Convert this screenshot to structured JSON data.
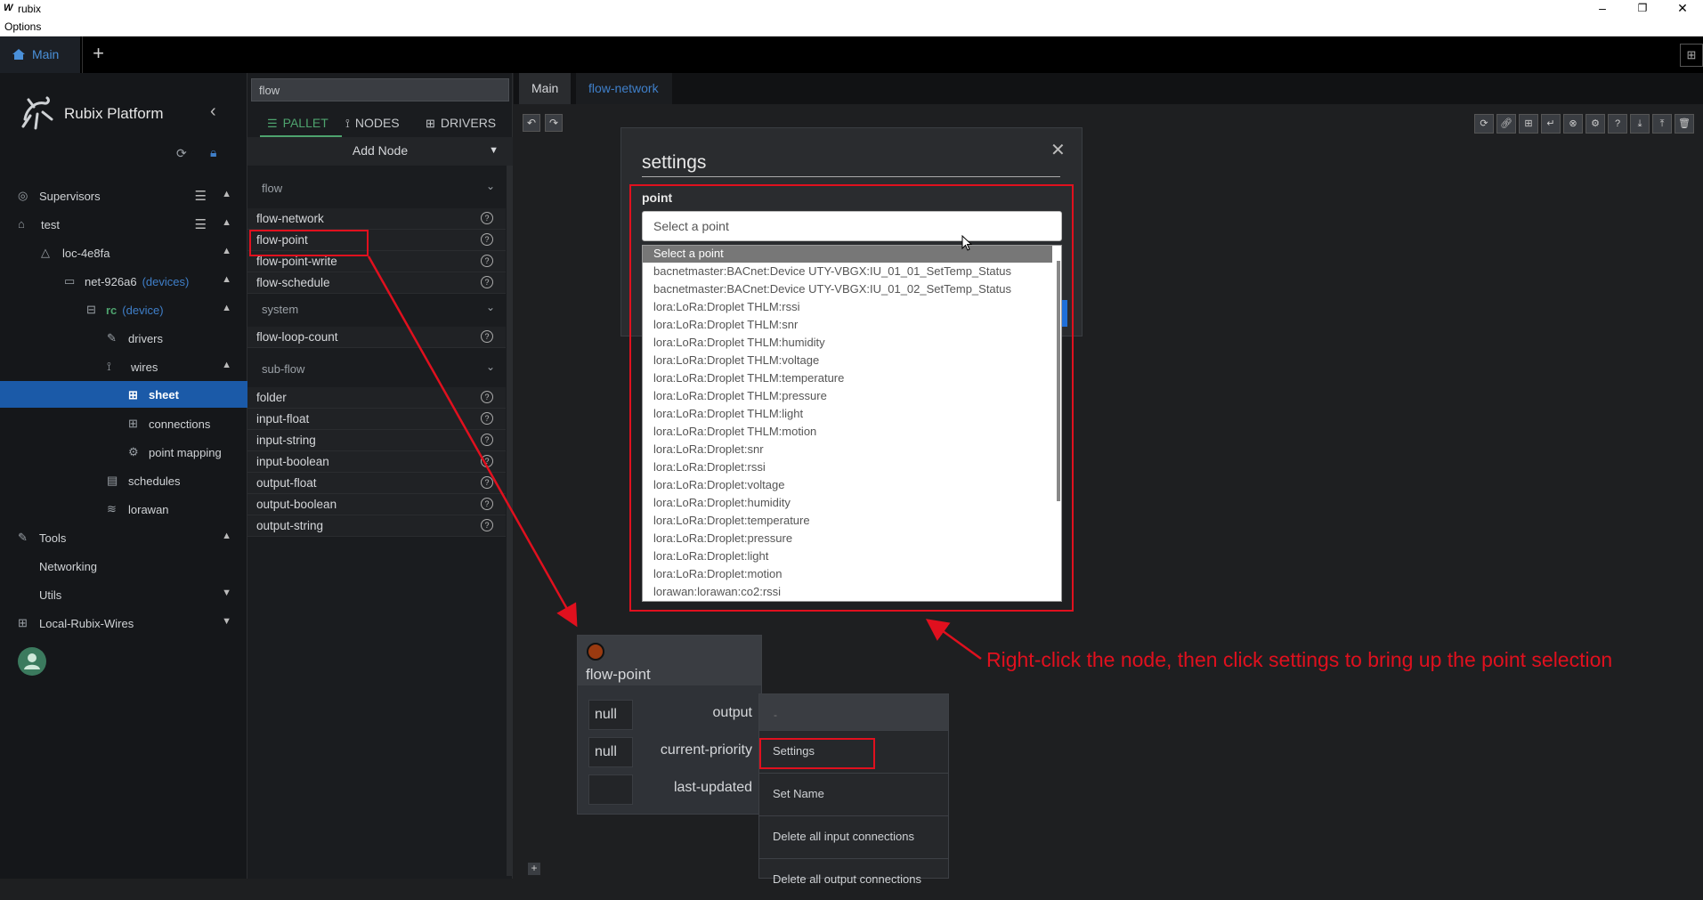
{
  "window": {
    "title": "rubix",
    "menu_options": "Options",
    "minimize": "–",
    "restore": "❐",
    "close": "✕"
  },
  "top_tabs": {
    "main": "Main",
    "add": "+"
  },
  "sidebar": {
    "brand": "Rubix Platform",
    "tree": [
      {
        "label": "Supervisors",
        "icon": "supervisors-icon"
      },
      {
        "label": "test",
        "icon": "home-icon"
      },
      {
        "label": "loc-4e8fa",
        "icon": "location-icon"
      },
      {
        "label": "net-926a6",
        "tag": "(devices)",
        "icon": "network-icon"
      },
      {
        "label": "rc",
        "tag": "(device)",
        "icon": "device-icon"
      },
      {
        "label": "drivers",
        "icon": "drivers-icon"
      },
      {
        "label": "wires",
        "icon": "wires-icon"
      },
      {
        "label": "sheet",
        "icon": "sheet-icon"
      },
      {
        "label": "connections",
        "icon": "connections-icon"
      },
      {
        "label": "point mapping",
        "icon": "point-mapping-icon"
      },
      {
        "label": "schedules",
        "icon": "schedules-icon"
      },
      {
        "label": "lorawan",
        "icon": "wifi-icon"
      },
      {
        "label": "Tools",
        "icon": "tools-icon"
      },
      {
        "label": "Networking"
      },
      {
        "label": "Utils"
      },
      {
        "label": "Local-Rubix-Wires",
        "icon": "local-wires-icon"
      }
    ]
  },
  "pallet": {
    "search_value": "flow",
    "tabs": [
      "PALLET",
      "NODES",
      "DRIVERS"
    ],
    "add_node": "Add Node",
    "groups": [
      "flow",
      "system",
      "sub-flow"
    ],
    "flow_items": [
      "flow-network",
      "flow-point",
      "flow-point-write",
      "flow-schedule"
    ],
    "system_items": [
      "flow-loop-count"
    ],
    "subflow_items": [
      "folder",
      "input-float",
      "input-string",
      "input-boolean",
      "output-float",
      "output-boolean",
      "output-string"
    ],
    "help": "?"
  },
  "canvas_tabs": [
    "Main",
    "flow-network"
  ],
  "node": {
    "title": "flow-point",
    "rows": [
      {
        "value": "null",
        "label": "output"
      },
      {
        "value": "null",
        "label": "current-priority"
      },
      {
        "value": "",
        "label": "last-updated"
      }
    ]
  },
  "context_menu": {
    "header": "-",
    "items": [
      "Settings",
      "Set Name",
      "Delete all input connections",
      "Delete all output connections"
    ]
  },
  "dialog": {
    "title": "settings",
    "close": "✕",
    "point_label": "point",
    "placeholder": "Select a point",
    "options": [
      "Select a point",
      "bacnetmaster:BACnet:Device UTY-VBGX:IU_01_01_SetTemp_Status",
      "bacnetmaster:BACnet:Device UTY-VBGX:IU_01_02_SetTemp_Status",
      "lora:LoRa:Droplet THLM:rssi",
      "lora:LoRa:Droplet THLM:snr",
      "lora:LoRa:Droplet THLM:humidity",
      "lora:LoRa:Droplet THLM:voltage",
      "lora:LoRa:Droplet THLM:temperature",
      "lora:LoRa:Droplet THLM:pressure",
      "lora:LoRa:Droplet THLM:light",
      "lora:LoRa:Droplet THLM:motion",
      "lora:LoRa:Droplet:snr",
      "lora:LoRa:Droplet:rssi",
      "lora:LoRa:Droplet:voltage",
      "lora:LoRa:Droplet:humidity",
      "lora:LoRa:Droplet:temperature",
      "lora:LoRa:Droplet:pressure",
      "lora:LoRa:Droplet:light",
      "lora:LoRa:Droplet:motion",
      "lorawan:lorawan:co2:rssi"
    ]
  },
  "annotation": "Right-click the node, then click settings to bring up the point selection",
  "colors": {
    "accent_blue": "#1b5aa8",
    "annotation_red": "#e0101e",
    "pallet_green": "#4ea36e"
  }
}
